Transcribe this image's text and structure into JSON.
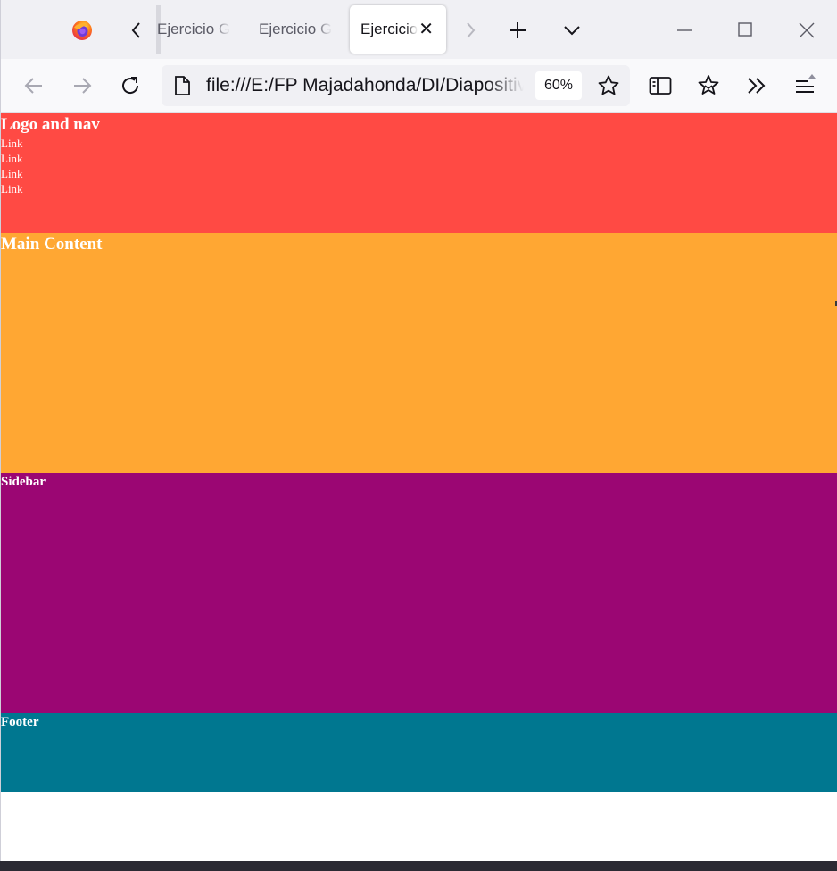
{
  "browser": {
    "tabs": [
      {
        "label": "Ejercicio G",
        "active": false
      },
      {
        "label": "Ejercicio G",
        "active": false
      },
      {
        "label": "Ejercicio",
        "active": true
      }
    ],
    "close_tab_glyph": "✕",
    "scroll_left_glyph": "‹",
    "scroll_right_glyph": "›",
    "url": "file:///E:/FP Majadahonda/DI/Diapositiv",
    "zoom": "60%",
    "icons": [
      "firefox-logo",
      "chevron-left-icon",
      "chevron-right-icon",
      "plus-icon",
      "chevron-down-icon",
      "minimize-icon",
      "maximize-icon",
      "close-icon",
      "back-arrow-icon",
      "forward-arrow-icon",
      "reload-icon",
      "page-icon",
      "star-icon",
      "sidebar-icon",
      "pocket-icon",
      "overflow-icon",
      "hamburger-menu-icon"
    ]
  },
  "page": {
    "header": {
      "title": "Logo and nav",
      "links": [
        "Link",
        "Link",
        "Link",
        "Link"
      ],
      "color": "#ff4a44"
    },
    "main": {
      "title": "Main Content",
      "color": "#ffa733"
    },
    "sidebar": {
      "title": "Sidebar",
      "color": "#9b0673"
    },
    "footer": {
      "title": "Footer",
      "color": "#007790"
    }
  }
}
